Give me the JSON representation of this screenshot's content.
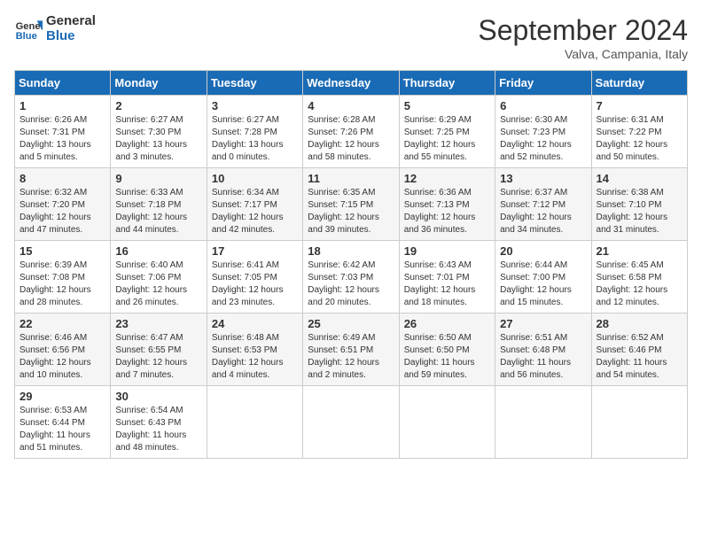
{
  "header": {
    "logo_line1": "General",
    "logo_line2": "Blue",
    "month_title": "September 2024",
    "location": "Valva, Campania, Italy"
  },
  "days_of_week": [
    "Sunday",
    "Monday",
    "Tuesday",
    "Wednesday",
    "Thursday",
    "Friday",
    "Saturday"
  ],
  "weeks": [
    [
      {
        "day": "1",
        "info": "Sunrise: 6:26 AM\nSunset: 7:31 PM\nDaylight: 13 hours and 5 minutes."
      },
      {
        "day": "2",
        "info": "Sunrise: 6:27 AM\nSunset: 7:30 PM\nDaylight: 13 hours and 3 minutes."
      },
      {
        "day": "3",
        "info": "Sunrise: 6:27 AM\nSunset: 7:28 PM\nDaylight: 13 hours and 0 minutes."
      },
      {
        "day": "4",
        "info": "Sunrise: 6:28 AM\nSunset: 7:26 PM\nDaylight: 12 hours and 58 minutes."
      },
      {
        "day": "5",
        "info": "Sunrise: 6:29 AM\nSunset: 7:25 PM\nDaylight: 12 hours and 55 minutes."
      },
      {
        "day": "6",
        "info": "Sunrise: 6:30 AM\nSunset: 7:23 PM\nDaylight: 12 hours and 52 minutes."
      },
      {
        "day": "7",
        "info": "Sunrise: 6:31 AM\nSunset: 7:22 PM\nDaylight: 12 hours and 50 minutes."
      }
    ],
    [
      {
        "day": "8",
        "info": "Sunrise: 6:32 AM\nSunset: 7:20 PM\nDaylight: 12 hours and 47 minutes."
      },
      {
        "day": "9",
        "info": "Sunrise: 6:33 AM\nSunset: 7:18 PM\nDaylight: 12 hours and 44 minutes."
      },
      {
        "day": "10",
        "info": "Sunrise: 6:34 AM\nSunset: 7:17 PM\nDaylight: 12 hours and 42 minutes."
      },
      {
        "day": "11",
        "info": "Sunrise: 6:35 AM\nSunset: 7:15 PM\nDaylight: 12 hours and 39 minutes."
      },
      {
        "day": "12",
        "info": "Sunrise: 6:36 AM\nSunset: 7:13 PM\nDaylight: 12 hours and 36 minutes."
      },
      {
        "day": "13",
        "info": "Sunrise: 6:37 AM\nSunset: 7:12 PM\nDaylight: 12 hours and 34 minutes."
      },
      {
        "day": "14",
        "info": "Sunrise: 6:38 AM\nSunset: 7:10 PM\nDaylight: 12 hours and 31 minutes."
      }
    ],
    [
      {
        "day": "15",
        "info": "Sunrise: 6:39 AM\nSunset: 7:08 PM\nDaylight: 12 hours and 28 minutes."
      },
      {
        "day": "16",
        "info": "Sunrise: 6:40 AM\nSunset: 7:06 PM\nDaylight: 12 hours and 26 minutes."
      },
      {
        "day": "17",
        "info": "Sunrise: 6:41 AM\nSunset: 7:05 PM\nDaylight: 12 hours and 23 minutes."
      },
      {
        "day": "18",
        "info": "Sunrise: 6:42 AM\nSunset: 7:03 PM\nDaylight: 12 hours and 20 minutes."
      },
      {
        "day": "19",
        "info": "Sunrise: 6:43 AM\nSunset: 7:01 PM\nDaylight: 12 hours and 18 minutes."
      },
      {
        "day": "20",
        "info": "Sunrise: 6:44 AM\nSunset: 7:00 PM\nDaylight: 12 hours and 15 minutes."
      },
      {
        "day": "21",
        "info": "Sunrise: 6:45 AM\nSunset: 6:58 PM\nDaylight: 12 hours and 12 minutes."
      }
    ],
    [
      {
        "day": "22",
        "info": "Sunrise: 6:46 AM\nSunset: 6:56 PM\nDaylight: 12 hours and 10 minutes."
      },
      {
        "day": "23",
        "info": "Sunrise: 6:47 AM\nSunset: 6:55 PM\nDaylight: 12 hours and 7 minutes."
      },
      {
        "day": "24",
        "info": "Sunrise: 6:48 AM\nSunset: 6:53 PM\nDaylight: 12 hours and 4 minutes."
      },
      {
        "day": "25",
        "info": "Sunrise: 6:49 AM\nSunset: 6:51 PM\nDaylight: 12 hours and 2 minutes."
      },
      {
        "day": "26",
        "info": "Sunrise: 6:50 AM\nSunset: 6:50 PM\nDaylight: 11 hours and 59 minutes."
      },
      {
        "day": "27",
        "info": "Sunrise: 6:51 AM\nSunset: 6:48 PM\nDaylight: 11 hours and 56 minutes."
      },
      {
        "day": "28",
        "info": "Sunrise: 6:52 AM\nSunset: 6:46 PM\nDaylight: 11 hours and 54 minutes."
      }
    ],
    [
      {
        "day": "29",
        "info": "Sunrise: 6:53 AM\nSunset: 6:44 PM\nDaylight: 11 hours and 51 minutes."
      },
      {
        "day": "30",
        "info": "Sunrise: 6:54 AM\nSunset: 6:43 PM\nDaylight: 11 hours and 48 minutes."
      },
      {
        "day": "",
        "info": ""
      },
      {
        "day": "",
        "info": ""
      },
      {
        "day": "",
        "info": ""
      },
      {
        "day": "",
        "info": ""
      },
      {
        "day": "",
        "info": ""
      }
    ]
  ]
}
